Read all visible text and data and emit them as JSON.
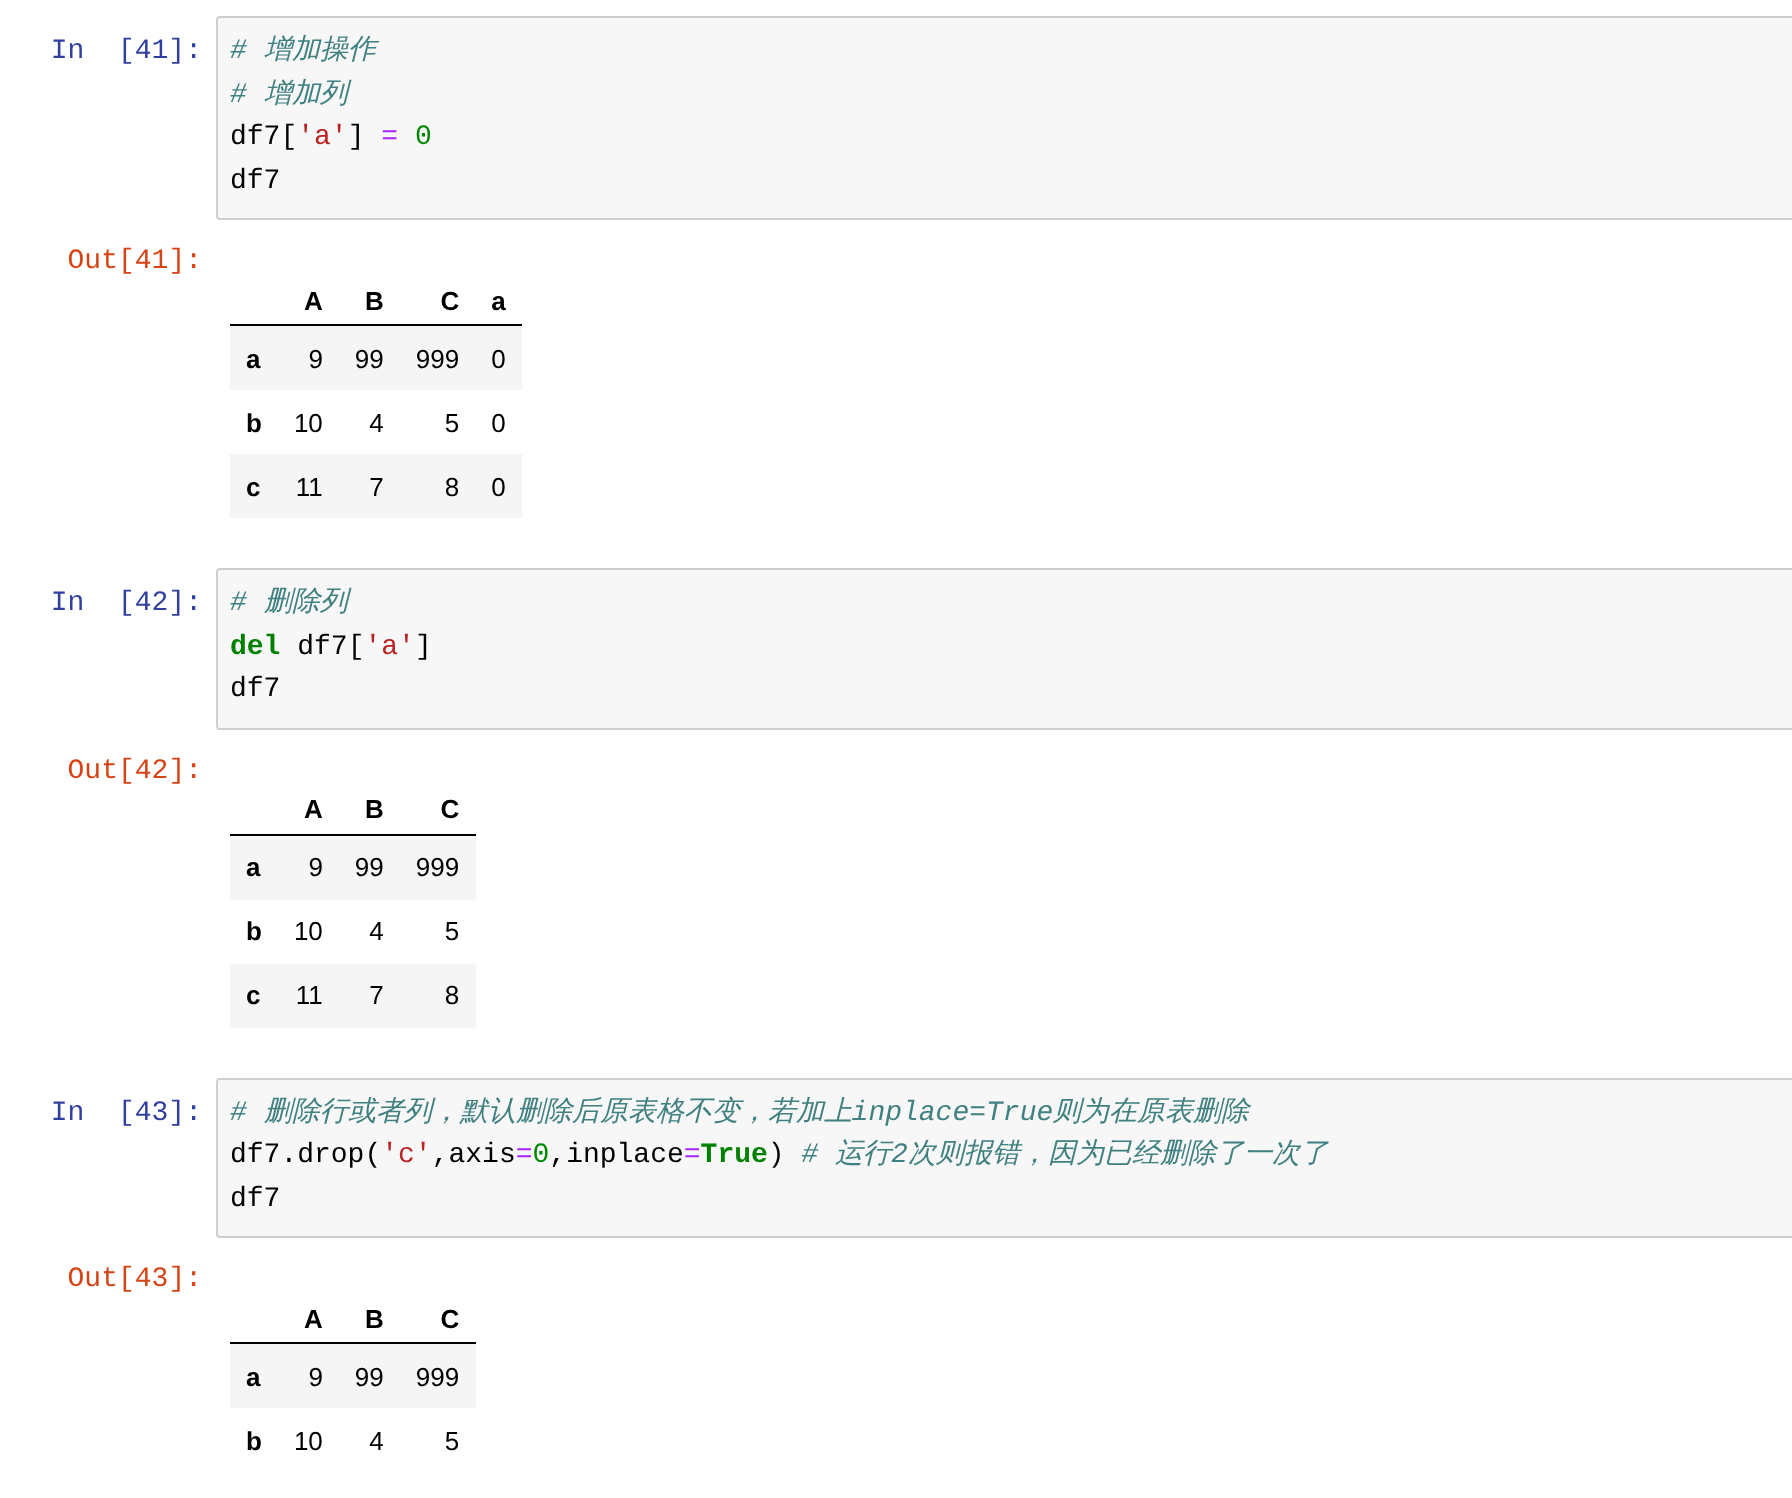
{
  "cells": [
    {
      "input_prompt": "In  [41]:",
      "code": [
        [
          {
            "kind": "comment",
            "text": "# 增加操作"
          }
        ],
        [
          {
            "kind": "comment",
            "text": "# 增加列"
          }
        ],
        [
          {
            "kind": "plain",
            "text": "df7["
          },
          {
            "kind": "string",
            "text": "'a'"
          },
          {
            "kind": "plain",
            "text": "] "
          },
          {
            "kind": "operator",
            "text": "="
          },
          {
            "kind": "number",
            "text": " 0"
          }
        ],
        [
          {
            "kind": "plain",
            "text": "df7"
          }
        ]
      ],
      "output_prompt": "Out[41]:",
      "table": {
        "columns": [
          "A",
          "B",
          "C",
          "a"
        ],
        "rows": [
          {
            "index": "a",
            "values": [
              "9",
              "99",
              "999",
              "0"
            ]
          },
          {
            "index": "b",
            "values": [
              "10",
              "4",
              "5",
              "0"
            ]
          },
          {
            "index": "c",
            "values": [
              "11",
              "7",
              "8",
              "0"
            ]
          }
        ]
      }
    },
    {
      "input_prompt": "In  [42]:",
      "code": [
        [
          {
            "kind": "comment",
            "text": "# 删除列"
          }
        ],
        [
          {
            "kind": "keyword",
            "text": "del"
          },
          {
            "kind": "plain",
            "text": " df7["
          },
          {
            "kind": "string",
            "text": "'a'"
          },
          {
            "kind": "plain",
            "text": "]"
          }
        ],
        [
          {
            "kind": "plain",
            "text": "df7"
          }
        ]
      ],
      "output_prompt": "Out[42]:",
      "table": {
        "columns": [
          "A",
          "B",
          "C"
        ],
        "rows": [
          {
            "index": "a",
            "values": [
              "9",
              "99",
              "999"
            ]
          },
          {
            "index": "b",
            "values": [
              "10",
              "4",
              "5"
            ]
          },
          {
            "index": "c",
            "values": [
              "11",
              "7",
              "8"
            ]
          }
        ]
      }
    },
    {
      "input_prompt": "In  [43]:",
      "code": [
        [
          {
            "kind": "comment",
            "text": "# 删除行或者列，默认删除后原表格不变，若加上inplace=True则为在原表删除"
          }
        ],
        [
          {
            "kind": "plain",
            "text": "df7.drop("
          },
          {
            "kind": "string",
            "text": "'c'"
          },
          {
            "kind": "plain",
            "text": ",axis"
          },
          {
            "kind": "operator",
            "text": "="
          },
          {
            "kind": "number",
            "text": "0"
          },
          {
            "kind": "plain",
            "text": ",inplace"
          },
          {
            "kind": "operator",
            "text": "="
          },
          {
            "kind": "keyword",
            "text": "True"
          },
          {
            "kind": "plain",
            "text": ") "
          },
          {
            "kind": "comment",
            "text": "# 运行2次则报错，因为已经删除了一次了"
          }
        ],
        [
          {
            "kind": "plain",
            "text": "df7"
          }
        ]
      ],
      "output_prompt": "Out[43]:",
      "table": {
        "columns": [
          "A",
          "B",
          "C"
        ],
        "rows": [
          {
            "index": "a",
            "values": [
              "9",
              "99",
              "999"
            ]
          },
          {
            "index": "b",
            "values": [
              "10",
              "4",
              "5"
            ]
          }
        ]
      }
    }
  ]
}
